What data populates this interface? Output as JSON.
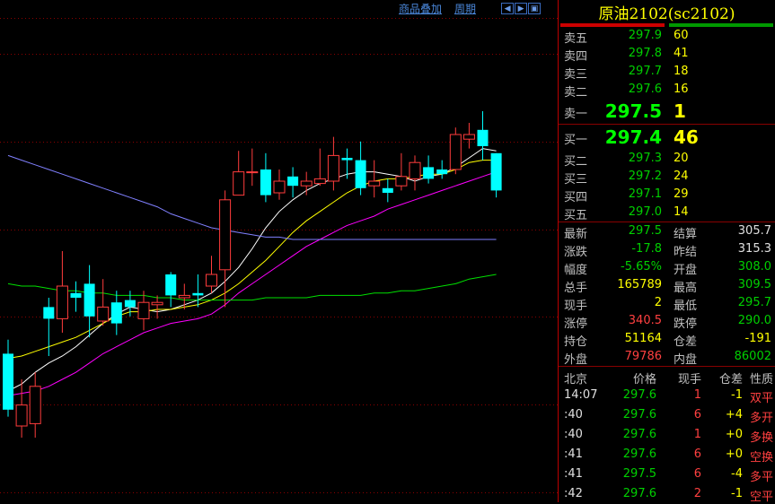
{
  "toolbar": {
    "overlay_label": "商品叠加",
    "period_label": "周期"
  },
  "title": "原油2102(sc2102)",
  "orderbook": {
    "asks": [
      {
        "label": "卖五",
        "price": "297.9",
        "vol": "60"
      },
      {
        "label": "卖四",
        "price": "297.8",
        "vol": "41"
      },
      {
        "label": "卖三",
        "price": "297.7",
        "vol": "18"
      },
      {
        "label": "卖二",
        "price": "297.6",
        "vol": "16"
      },
      {
        "label": "卖一",
        "price": "297.5",
        "vol": "1"
      }
    ],
    "bids": [
      {
        "label": "买一",
        "price": "297.4",
        "vol": "46"
      },
      {
        "label": "买二",
        "price": "297.3",
        "vol": "20"
      },
      {
        "label": "买三",
        "price": "297.2",
        "vol": "24"
      },
      {
        "label": "买四",
        "price": "297.1",
        "vol": "29"
      },
      {
        "label": "买五",
        "price": "297.0",
        "vol": "14"
      }
    ]
  },
  "stats": [
    {
      "l1": "最新",
      "v1": "297.5",
      "c1": "g",
      "l2": "结算",
      "v2": "305.7",
      "c2": "w"
    },
    {
      "l1": "涨跌",
      "v1": "-17.8",
      "c1": "g",
      "l2": "昨结",
      "v2": "315.3",
      "c2": "w"
    },
    {
      "l1": "幅度",
      "v1": "-5.65%",
      "c1": "g",
      "l2": "开盘",
      "v2": "308.0",
      "c2": "g"
    },
    {
      "l1": "总手",
      "v1": "165789",
      "c1": "y",
      "l2": "最高",
      "v2": "309.5",
      "c2": "g"
    },
    {
      "l1": "现手",
      "v1": "2",
      "c1": "y",
      "l2": "最低",
      "v2": "295.7",
      "c2": "g"
    },
    {
      "l1": "涨停",
      "v1": "340.5",
      "c1": "r",
      "l2": "跌停",
      "v2": "290.0",
      "c2": "g"
    },
    {
      "l1": "持仓",
      "v1": "51164",
      "c1": "y",
      "l2": "仓差",
      "v2": "-191",
      "c2": "y"
    },
    {
      "l1": "外盘",
      "v1": "79786",
      "c1": "r",
      "l2": "内盘",
      "v2": "86002",
      "c2": "g"
    }
  ],
  "ticks_header": [
    "北京",
    "价格",
    "现手",
    "仓差",
    "性质"
  ],
  "ticks": [
    {
      "time": "14:07",
      "price": "297.6",
      "qty": "1",
      "diff": "-1",
      "type": "双平"
    },
    {
      "time": ":40",
      "price": "297.6",
      "qty": "6",
      "diff": "+4",
      "type": "多开"
    },
    {
      "time": ":40",
      "price": "297.6",
      "qty": "1",
      "diff": "+0",
      "type": "多换"
    },
    {
      "time": ":41",
      "price": "297.6",
      "qty": "6",
      "diff": "+0",
      "type": "空换"
    },
    {
      "time": ":41",
      "price": "297.5",
      "qty": "6",
      "diff": "-4",
      "type": "多平"
    },
    {
      "time": ":42",
      "price": "297.6",
      "qty": "2",
      "diff": "-1",
      "type": "空平"
    }
  ],
  "chart_colors": {
    "up": "#ff3c3c",
    "down": "#00ffff",
    "ma5": "#ffffff",
    "ma10": "#ffff00",
    "ma20": "#ff00ff",
    "ma40": "#00e000",
    "ma60": "#8080ff"
  },
  "candles": [
    {
      "o": 300.6,
      "c": 298.2,
      "h": 301.2,
      "l": 297.9
    },
    {
      "o": 297.5,
      "c": 298.4,
      "h": 299.5,
      "l": 297.0
    },
    {
      "o": 297.6,
      "c": 299.2,
      "h": 299.8,
      "l": 297.0
    },
    {
      "o": 302.6,
      "c": 302.1,
      "h": 303.0,
      "l": 300.5
    },
    {
      "o": 302.1,
      "c": 303.5,
      "h": 305.0,
      "l": 301.5
    },
    {
      "o": 303.2,
      "c": 303.0,
      "h": 303.7,
      "l": 302.4
    },
    {
      "o": 303.6,
      "c": 302.2,
      "h": 304.4,
      "l": 301.3
    },
    {
      "o": 302.0,
      "c": 302.6,
      "h": 303.8,
      "l": 301.8
    },
    {
      "o": 302.8,
      "c": 301.9,
      "h": 303.3,
      "l": 301.4
    },
    {
      "o": 302.9,
      "c": 302.6,
      "h": 303.3,
      "l": 302.2
    },
    {
      "o": 302.1,
      "c": 302.8,
      "h": 303.3,
      "l": 301.6
    },
    {
      "o": 302.7,
      "c": 302.8,
      "h": 303.1,
      "l": 302.1
    },
    {
      "o": 304.0,
      "c": 303.1,
      "h": 304.1,
      "l": 302.6
    },
    {
      "o": 303.0,
      "c": 303.1,
      "h": 303.6,
      "l": 302.5
    },
    {
      "o": 303.2,
      "c": 303.1,
      "h": 304.0,
      "l": 302.6
    },
    {
      "o": 303.5,
      "c": 304.0,
      "h": 304.8,
      "l": 303.2
    },
    {
      "o": 304.2,
      "c": 307.2,
      "h": 307.6,
      "l": 302.6
    },
    {
      "o": 307.4,
      "c": 308.4,
      "h": 309.3,
      "l": 307.4
    },
    {
      "o": 308.4,
      "c": 308.4,
      "h": 309.4,
      "l": 307.8
    },
    {
      "o": 308.5,
      "c": 307.4,
      "h": 309.2,
      "l": 307.1
    },
    {
      "o": 307.5,
      "c": 308.0,
      "h": 308.5,
      "l": 307.2
    },
    {
      "o": 308.2,
      "c": 307.8,
      "h": 308.6,
      "l": 307.3
    },
    {
      "o": 307.8,
      "c": 308.0,
      "h": 308.4,
      "l": 307.4
    },
    {
      "o": 307.9,
      "c": 308.1,
      "h": 309.4,
      "l": 307.8
    },
    {
      "o": 308.0,
      "c": 309.1,
      "h": 309.9,
      "l": 307.6
    },
    {
      "o": 309.0,
      "c": 308.9,
      "h": 309.4,
      "l": 308.1
    },
    {
      "o": 308.9,
      "c": 307.7,
      "h": 309.7,
      "l": 307.4
    },
    {
      "o": 307.8,
      "c": 308.0,
      "h": 308.9,
      "l": 307.3
    },
    {
      "o": 307.7,
      "c": 307.5,
      "h": 308.1,
      "l": 307.1
    },
    {
      "o": 307.8,
      "c": 308.2,
      "h": 309.2,
      "l": 307.6
    },
    {
      "o": 308.1,
      "c": 308.8,
      "h": 309.1,
      "l": 307.6
    },
    {
      "o": 308.6,
      "c": 308.1,
      "h": 309.1,
      "l": 307.9
    },
    {
      "o": 308.5,
      "c": 308.3,
      "h": 308.9,
      "l": 308.1
    },
    {
      "o": 308.5,
      "c": 310.0,
      "h": 310.3,
      "l": 308.3
    },
    {
      "o": 309.8,
      "c": 310.0,
      "h": 310.5,
      "l": 309.4
    },
    {
      "o": 310.2,
      "c": 309.5,
      "h": 311.0,
      "l": 308.9
    },
    {
      "o": 309.2,
      "c": 307.6,
      "h": 309.2,
      "l": 307.3
    }
  ],
  "ma": {
    "ma5": [
      299.0,
      299.3,
      299.8,
      300.2,
      300.5,
      300.9,
      301.4,
      301.9,
      302.3,
      302.6,
      302.5,
      302.4,
      302.5,
      302.7,
      302.9,
      303.2,
      303.7,
      304.3,
      305.1,
      306.0,
      306.7,
      307.2,
      307.6,
      307.9,
      308.1,
      308.3,
      308.4,
      308.4,
      308.3,
      308.2,
      308.0,
      308.2,
      308.3,
      308.6,
      309.0,
      309.4,
      309.3
    ],
    "ma10": [
      300.4,
      300.5,
      300.7,
      300.9,
      301.1,
      301.3,
      301.6,
      301.9,
      302.2,
      302.4,
      302.4,
      302.5,
      302.5,
      302.6,
      302.7,
      302.9,
      303.2,
      303.6,
      304.1,
      304.6,
      305.2,
      305.8,
      306.3,
      306.7,
      307.1,
      307.5,
      307.8,
      308.0,
      308.1,
      308.1,
      308.2,
      308.3,
      308.3,
      308.5,
      308.8,
      308.9,
      308.9
    ],
    "ma20": [
      298.8,
      298.9,
      299.0,
      299.2,
      299.5,
      299.8,
      300.2,
      300.6,
      300.9,
      301.2,
      301.5,
      301.7,
      301.9,
      302.0,
      302.1,
      302.3,
      302.7,
      303.2,
      303.6,
      304.0,
      304.4,
      304.8,
      305.2,
      305.5,
      305.8,
      306.1,
      306.3,
      306.5,
      306.8,
      307.0,
      307.2,
      307.4,
      307.6,
      307.8,
      308.0,
      308.2,
      308.4
    ],
    "ma40": [
      303.6,
      303.5,
      303.5,
      303.4,
      303.3,
      303.3,
      303.2,
      303.2,
      303.1,
      303.1,
      303.1,
      303.0,
      303.0,
      302.9,
      302.9,
      302.9,
      302.9,
      302.9,
      302.9,
      303.0,
      303.0,
      303.0,
      303.0,
      303.1,
      303.1,
      303.1,
      303.1,
      303.2,
      303.2,
      303.3,
      303.3,
      303.4,
      303.5,
      303.6,
      303.8,
      303.9,
      304.0
    ],
    "ma60": [
      309.1,
      308.9,
      308.7,
      308.5,
      308.3,
      308.1,
      307.9,
      307.7,
      307.5,
      307.3,
      307.1,
      306.9,
      306.6,
      306.4,
      306.2,
      306.0,
      305.9,
      305.8,
      305.7,
      305.6,
      305.6,
      305.5,
      305.5,
      305.5,
      305.5,
      305.5,
      305.5,
      305.5,
      305.5,
      305.5,
      305.5,
      305.5,
      305.5,
      305.5,
      305.5,
      305.5,
      305.5
    ]
  }
}
